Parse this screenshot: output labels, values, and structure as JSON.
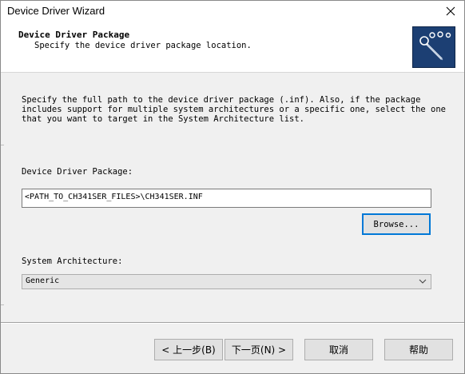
{
  "window": {
    "title": "Device Driver Wizard"
  },
  "header": {
    "title": "Device Driver Package",
    "subtitle": "Specify the device driver package location."
  },
  "body": {
    "description": "Specify the full path to the device driver package (.inf). Also, if the package includes support for multiple system architectures or a specific one, select the one that you want to target in the System Architecture list.",
    "package_label": "Device Driver Package:",
    "package_path": "<PATH_TO_CH341SER_FILES>\\CH341SER.INF",
    "browse_label": "Browse...",
    "architecture_label": "System Architecture:",
    "architecture_value": "Generic"
  },
  "footer": {
    "back_label": "< 上一步(B)",
    "next_label": "下一页(N) >",
    "cancel_label": "取消",
    "help_label": "帮助"
  },
  "icons": {
    "close": "close-icon",
    "logo": "wizard-logo-icon",
    "dropdown": "chevron-down-icon"
  },
  "colors": {
    "logo_bg": "#1c3f73",
    "focus_border": "#0078d7"
  }
}
